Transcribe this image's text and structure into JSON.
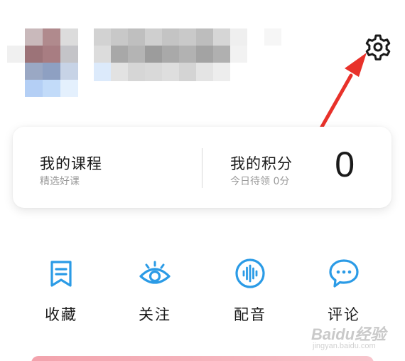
{
  "profile": {
    "avatar_icon": "blurred-avatar",
    "name_icon": "blurred-username"
  },
  "header": {
    "settings_icon": "gear-icon"
  },
  "card": {
    "courses": {
      "title": "我的课程",
      "subtitle": "精选好课"
    },
    "points": {
      "title": "我的积分",
      "subtitle": "今日待领 0分",
      "value": "0"
    }
  },
  "actions": [
    {
      "label": "收藏",
      "icon": "bookmark-icon"
    },
    {
      "label": "关注",
      "icon": "eye-icon"
    },
    {
      "label": "配音",
      "icon": "voice-wave-icon"
    },
    {
      "label": "评论",
      "icon": "comment-icon"
    }
  ],
  "colors": {
    "accent": "#2b9be6",
    "annotation": "#e8312a",
    "banner": "#f3a3ad"
  },
  "watermark": {
    "line1": "Baidu经验",
    "line2": "jingyan.baidu.com"
  }
}
